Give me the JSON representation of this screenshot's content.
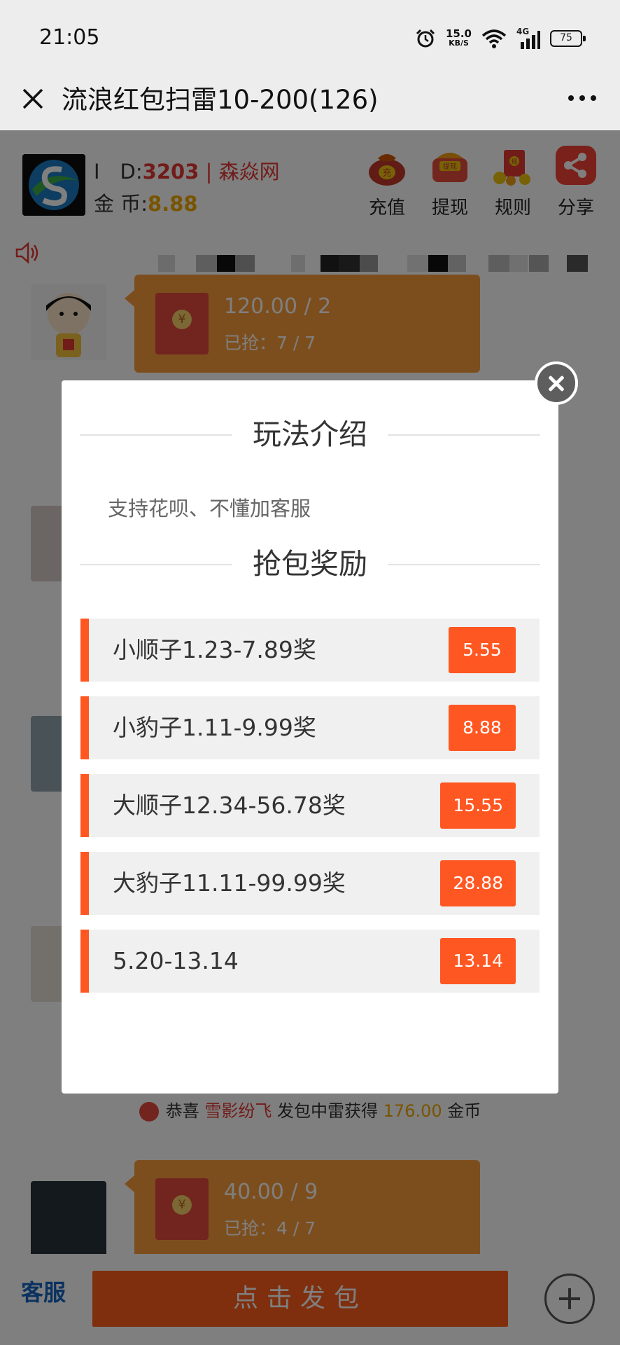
{
  "status_bar": {
    "time": "21:05",
    "speed_value": "15.0",
    "speed_unit": "KB/S",
    "network": "4G",
    "battery": "75"
  },
  "title_bar": {
    "title": "流浪红包扫雷10-200(126)"
  },
  "user_header": {
    "id_label": "I　D:",
    "id_value": "3203",
    "separator": " | ",
    "site_name": "森焱网",
    "coin_label": "金 币:",
    "coin_value": "8.88",
    "actions": [
      {
        "label": "充值",
        "icon": "money-bag-icon",
        "badge": "充"
      },
      {
        "label": "提现",
        "icon": "withdraw-bag-icon",
        "badge": "提现"
      },
      {
        "label": "规则",
        "icon": "rules-gift-icon",
        "badge": "规"
      },
      {
        "label": "分享",
        "icon": "share-icon"
      }
    ]
  },
  "chat": {
    "messages": [
      {
        "amount": "120.00 / 2",
        "grabbed": "已抢：7 / 7"
      },
      {
        "amount": "40.00 / 9",
        "grabbed": "已抢：4 / 7"
      }
    ],
    "win_notice": {
      "prefix": "恭喜",
      "name": "雪影纷飞",
      "middle": "发包中雷获得",
      "amount": "176.00",
      "suffix": "金币"
    }
  },
  "bottom_bar": {
    "customer_service": "客服",
    "send_button": "点击发包"
  },
  "modal": {
    "title": "玩法介绍",
    "intro_text": "支持花呗、不懂加客服",
    "reward_title": "抢包奖励",
    "rewards": [
      {
        "label": "小顺子1.23-7.89奖",
        "value": "5.55"
      },
      {
        "label": "小豹子1.11-9.99奖",
        "value": "8.88"
      },
      {
        "label": "大顺子12.34-56.78奖",
        "value": "15.55"
      },
      {
        "label": "大豹子11.11-99.99奖",
        "value": "28.88"
      },
      {
        "label": "5.20-13.14",
        "value": "13.14"
      }
    ]
  },
  "colors": {
    "accent": "#ff5722",
    "red": "#e53935",
    "gold": "#f2a900",
    "bubble": "#fa9d3b"
  }
}
